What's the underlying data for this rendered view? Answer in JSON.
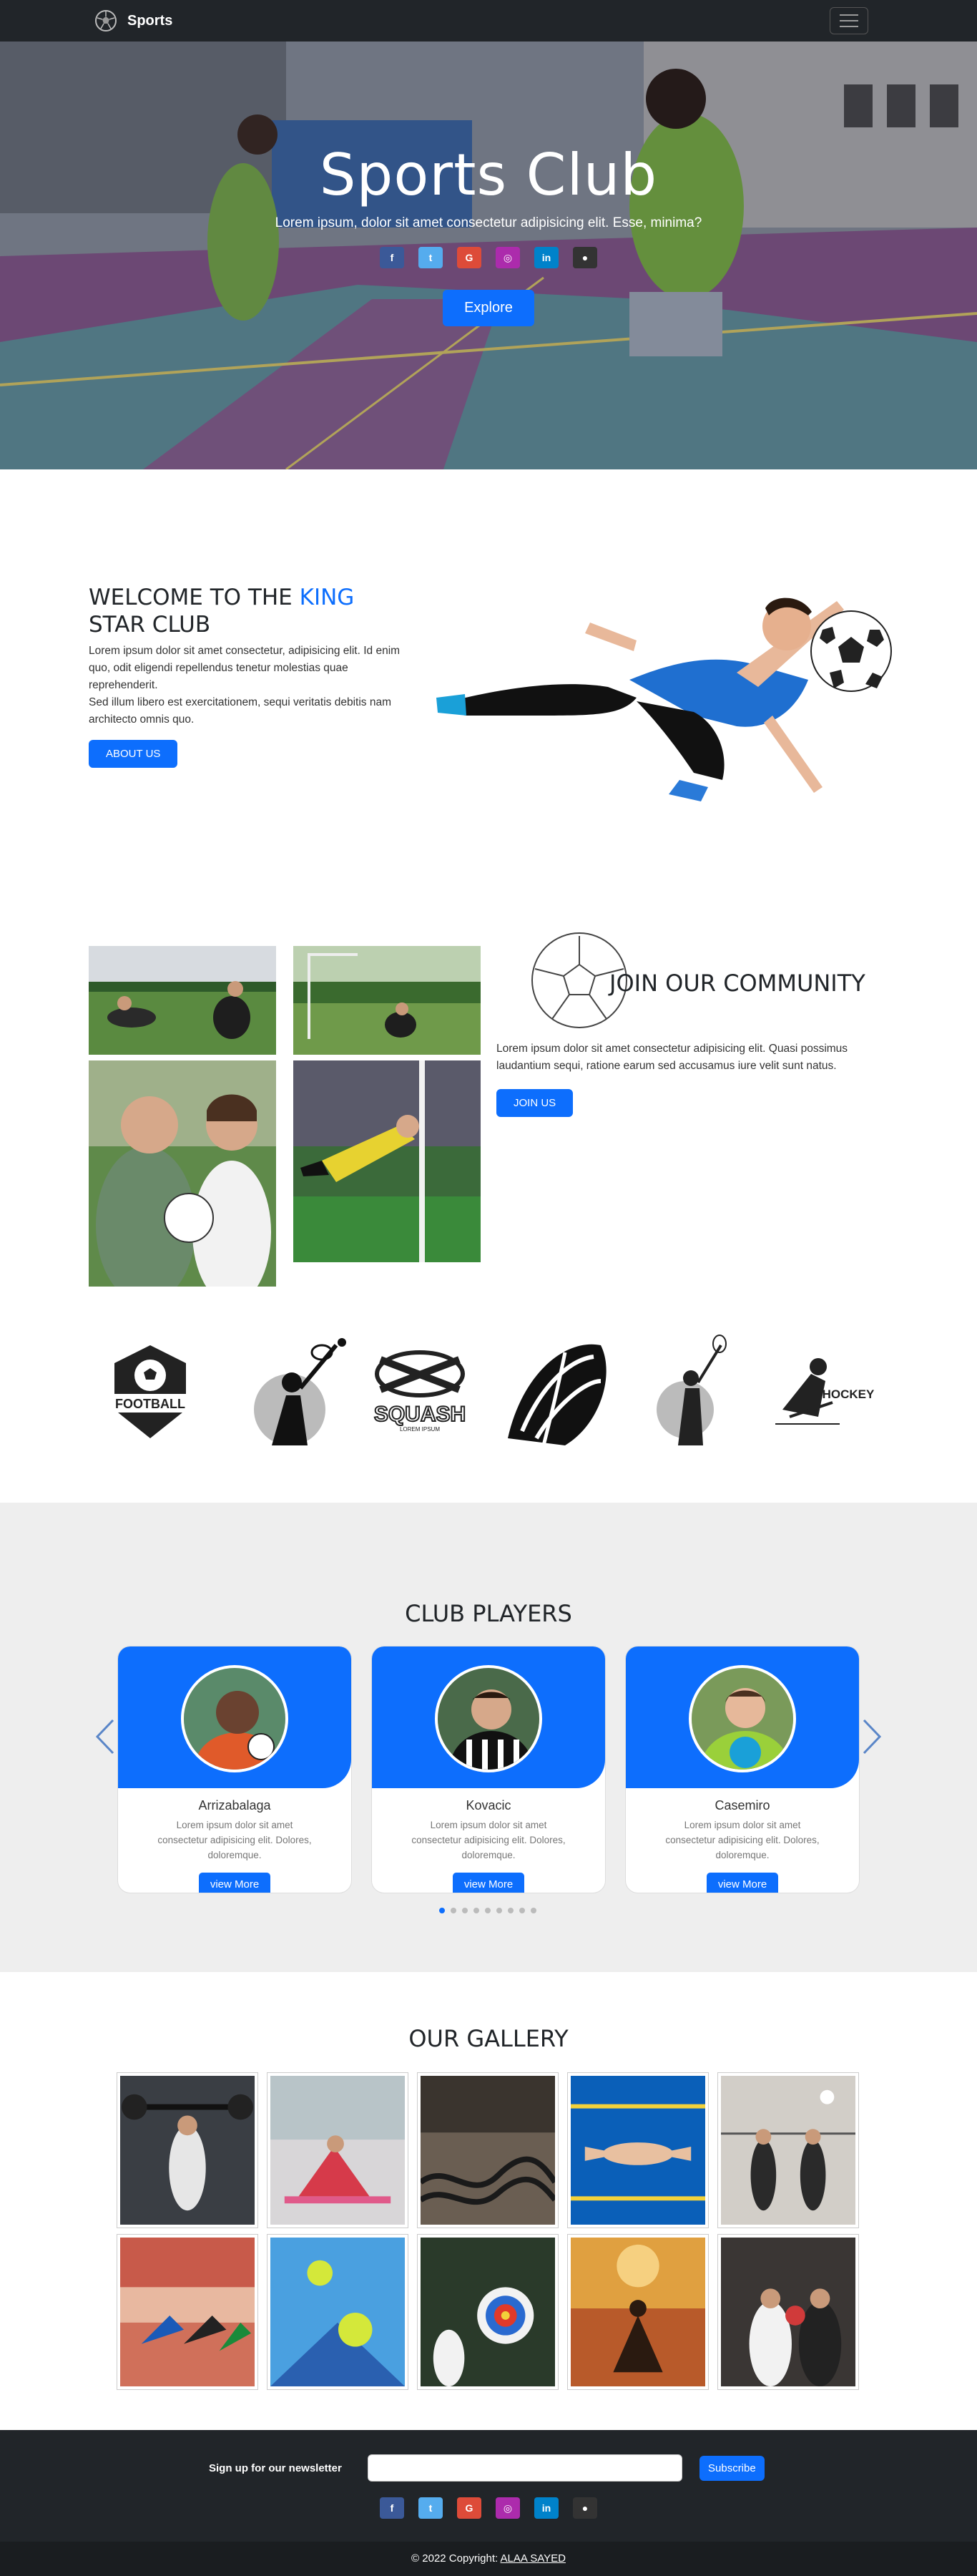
{
  "navbar": {
    "brand": "Sports",
    "brand_icon": "soccer-ball-icon",
    "menu_icon": "hamburger-icon"
  },
  "hero": {
    "title": "Sports Club",
    "subtitle": "Lorem ipsum, dolor sit amet consectetur adipisicing elit. Esse, minima?",
    "explore_label": "Explore",
    "social": [
      {
        "icon": "facebook-icon",
        "glyph": "f",
        "color": "#3b5998"
      },
      {
        "icon": "twitter-icon",
        "glyph": "t",
        "color": "#55acee"
      },
      {
        "icon": "google-icon",
        "glyph": "G",
        "color": "#dd4b39"
      },
      {
        "icon": "instagram-icon",
        "glyph": "◎",
        "color": "#ac2bac"
      },
      {
        "icon": "linkedin-icon",
        "glyph": "in",
        "color": "#0082ca"
      },
      {
        "icon": "github-icon",
        "glyph": "●",
        "color": "#333333"
      }
    ]
  },
  "welcome": {
    "title_pre": "WELCOME TO THE ",
    "title_accent": "KING",
    "title_post": " STAR CLUB",
    "paragraph1": "Lorem ipsum dolor sit amet consectetur, adipisicing elit. Id enim quo, odit eligendi repellendus tenetur molestias quae reprehenderit.",
    "paragraph2": "Sed illum libero est exercitationem, sequi veritatis debitis nam architecto omnis quo.",
    "button": "ABOUT US"
  },
  "community": {
    "title": "JOIN OUR COMMUNITY",
    "paragraph": "Lorem ipsum dolor sit amet consectetur adipisicing elit. Quasi possimus laudantium sequi, ratione earum sed accusamus iure velit sunt natus.",
    "button": "JOIN US"
  },
  "logos": [
    {
      "name": "football-logo",
      "text": "FOOTBALL"
    },
    {
      "name": "tennis-logo",
      "text": ""
    },
    {
      "name": "squash-logo",
      "text": "SQUASH",
      "subtext": "LOREM IPSUM"
    },
    {
      "name": "basketball-logo",
      "text": ""
    },
    {
      "name": "tennis-player-logo",
      "text": ""
    },
    {
      "name": "hockey-logo",
      "text": "HOCKEY"
    }
  ],
  "players": {
    "title": "CLUB PLAYERS",
    "items": [
      {
        "name": "Arrizabalaga",
        "text": "Lorem ipsum dolor sit amet consectetur adipisicing elit. Dolores, doloremque.",
        "button": "view More"
      },
      {
        "name": "Kovacic",
        "text": "Lorem ipsum dolor sit amet consectetur adipisicing elit. Dolores, doloremque.",
        "button": "view More"
      },
      {
        "name": "Casemiro",
        "text": "Lorem ipsum dolor sit amet consectetur adipisicing elit. Dolores, doloremque.",
        "button": "view More"
      }
    ],
    "dots_total": 9,
    "dots_active": 1
  },
  "gallery": {
    "title": "OUR GALLERY"
  },
  "footer": {
    "newsletter_label": "Sign up for our newsletter",
    "subscribe_label": "Subscribe",
    "copyright_text": "© 2022 Copyright: ",
    "copyright_link": "ALAA SAYED"
  },
  "colors": {
    "primary": "#0d6efd",
    "dark": "#212529",
    "section_gray": "#eeeeee"
  }
}
